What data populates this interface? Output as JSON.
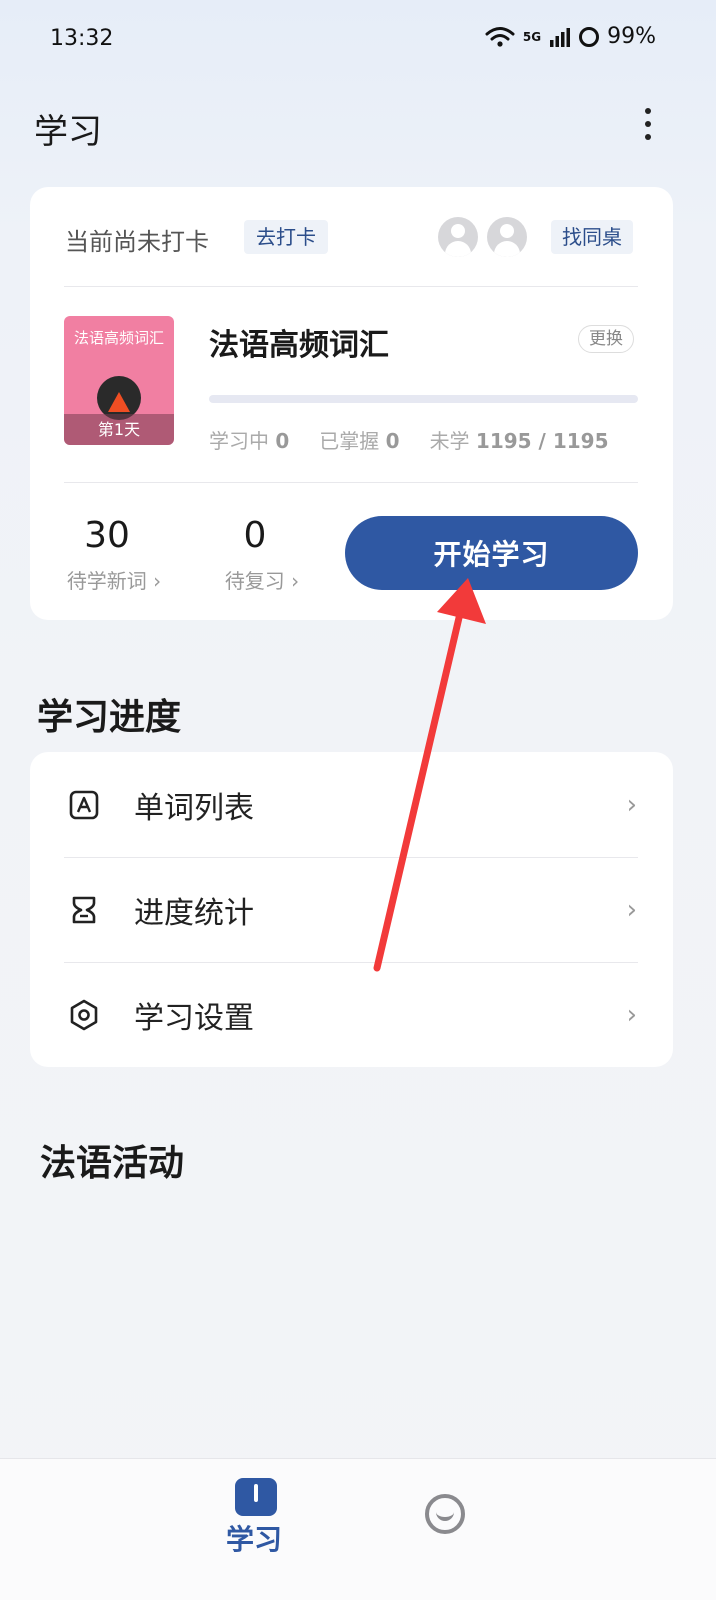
{
  "status_bar": {
    "time": "13:32",
    "signal": "5G",
    "battery": "99%"
  },
  "header": {
    "title": "学习"
  },
  "checkin": {
    "status_text": "当前尚未打卡",
    "checkin_button": "去打卡",
    "deskmate_button": "找同桌"
  },
  "book": {
    "cover_title": "法语高频词汇",
    "cover_day": "第1天",
    "name": "法语高频词汇",
    "change_button": "更换",
    "progress_fraction": 0,
    "stats": {
      "learning_label": "学习中",
      "learning_value": "0",
      "mastered_label": "已掌握",
      "mastered_value": "0",
      "unlearned_label": "未学",
      "unlearned_value": "1195 / 1195"
    }
  },
  "counters": {
    "new_words_value": "30",
    "new_words_label": "待学新词 ›",
    "review_value": "0",
    "review_label": "待复习 ›"
  },
  "start_button": "开始学习",
  "progress_section": {
    "title": "学习进度",
    "items": [
      {
        "label": "单词列表",
        "icon": "letter-a-icon"
      },
      {
        "label": "进度统计",
        "icon": "hourglass-icon"
      },
      {
        "label": "学习设置",
        "icon": "hexagon-settings-icon"
      }
    ]
  },
  "activities_section": {
    "title": "法语活动"
  },
  "bottom_nav": {
    "study_label": "学习"
  },
  "colors": {
    "accent": "#2f58a3",
    "annotation_arrow": "#f23a3a",
    "cover": "#f17fa2"
  }
}
